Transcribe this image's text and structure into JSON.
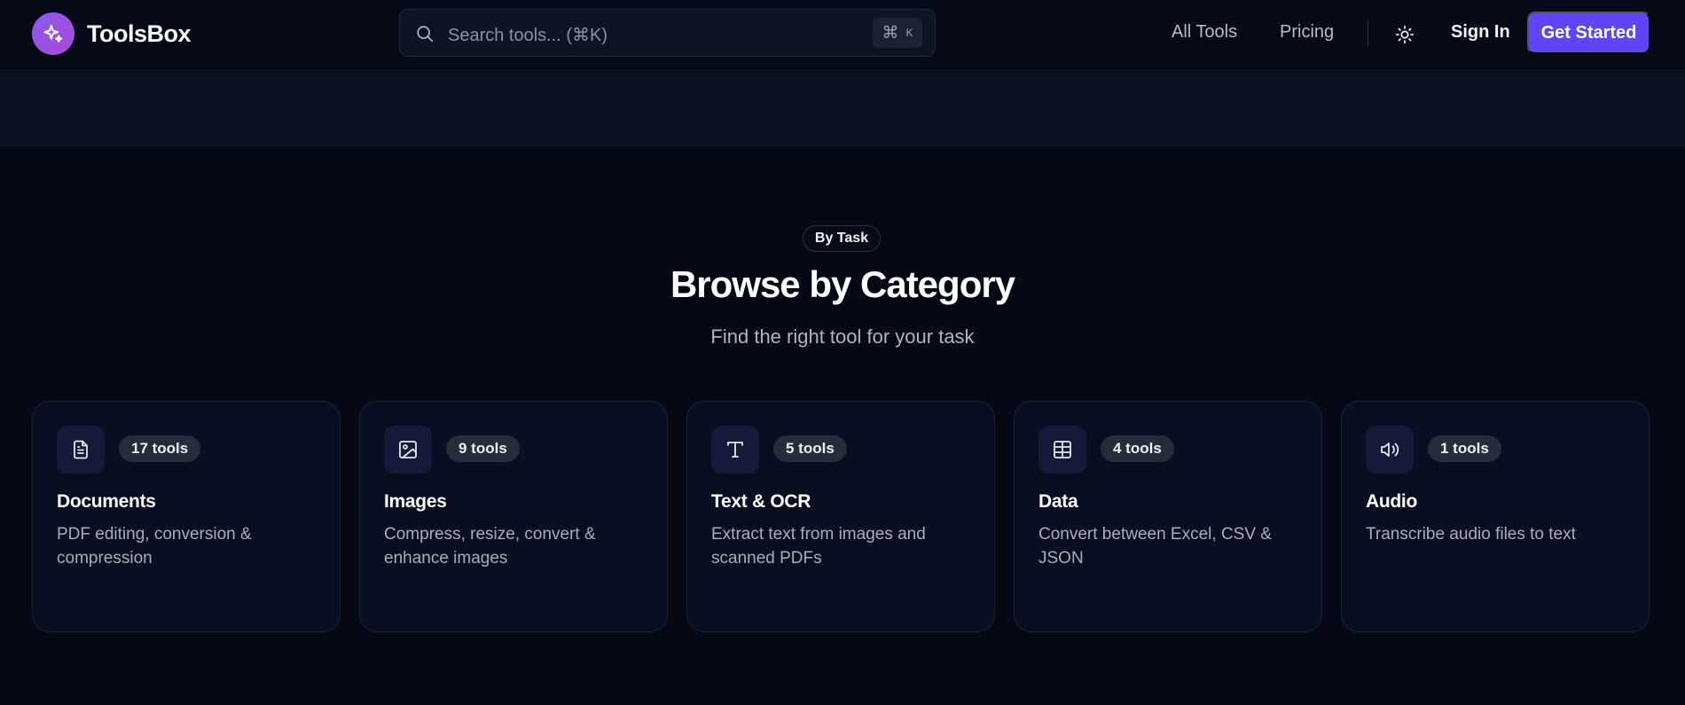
{
  "header": {
    "brand_name": "ToolsBox",
    "search_placeholder": "Search tools... (⌘K)",
    "search_shortcut_symbol": "⌘",
    "search_shortcut_key": "K",
    "nav": {
      "all_tools": "All Tools",
      "pricing": "Pricing"
    },
    "sign_in": "Sign In",
    "get_started": "Get Started"
  },
  "section": {
    "badge": "By Task",
    "title": "Browse by Category",
    "subtitle": "Find the right tool for your task"
  },
  "categories": [
    {
      "icon": "document-icon",
      "count": "17 tools",
      "title": "Documents",
      "description": "PDF editing, conversion & compression"
    },
    {
      "icon": "image-icon",
      "count": "9 tools",
      "title": "Images",
      "description": "Compress, resize, convert & enhance images"
    },
    {
      "icon": "text-icon",
      "count": "5 tools",
      "title": "Text & OCR",
      "description": "Extract text from images and scanned PDFs"
    },
    {
      "icon": "table-icon",
      "count": "4 tools",
      "title": "Data",
      "description": "Convert between Excel, CSV & JSON"
    },
    {
      "icon": "speaker-icon",
      "count": "1 tools",
      "title": "Audio",
      "description": "Transcribe audio files to text"
    }
  ],
  "colors": {
    "background": "#050915",
    "accent": "#6145f5",
    "logo_gradient_start": "#8b5cf6",
    "logo_gradient_end": "#b047d7"
  }
}
